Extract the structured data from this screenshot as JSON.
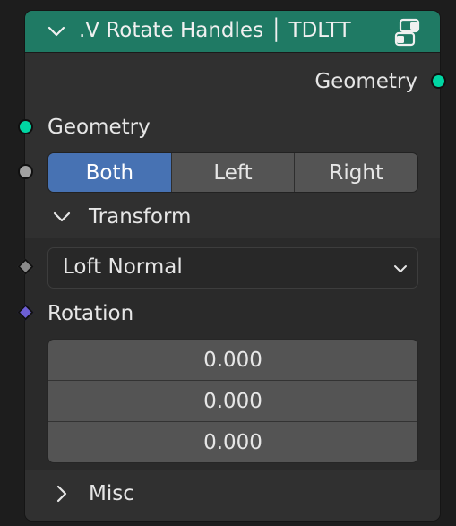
{
  "node": {
    "title": ".V Rotate Handles │ TDLTT",
    "header_color": "#1f7a64",
    "output": {
      "label": "Geometry",
      "socket_color": "#00d6a3"
    },
    "input_geometry": {
      "label": "Geometry",
      "socket_color": "#00d6a3"
    },
    "mode": {
      "options": [
        "Both",
        "Left",
        "Right"
      ],
      "selected": "Both"
    },
    "transform_panel": {
      "label": "Transform",
      "expanded": true,
      "mode_dropdown": {
        "value": "Loft Normal"
      },
      "rotation": {
        "label": "Rotation",
        "socket_color": "#6d5fd6",
        "values": [
          "0.000",
          "0.000",
          "0.000"
        ]
      }
    },
    "misc_panel": {
      "label": "Misc",
      "expanded": false
    }
  }
}
